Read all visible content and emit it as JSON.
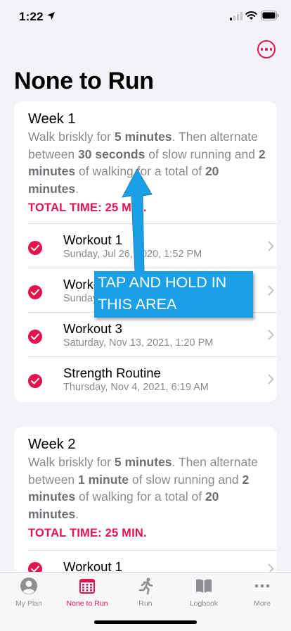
{
  "status_bar": {
    "time": "1:22"
  },
  "header": {
    "title": "None to Run"
  },
  "weeks": [
    {
      "title": "Week 1",
      "desc": {
        "p1": "Walk briskly for ",
        "b1": "5 minutes",
        "p2": ". Then alternate between ",
        "b2": "30 seconds",
        "p3": " of slow running and ",
        "b3": "2 minutes",
        "p4": " of walking for a total of ",
        "b4": "20 minutes",
        "p5": "."
      },
      "total": "TOTAL TIME: 25 MIN.",
      "workouts": [
        {
          "title": "Workout 1",
          "subtitle": "Sunday, Jul 26, 2020, 1:52 PM"
        },
        {
          "title": "Workout 2",
          "subtitle": "Sunday, Jul 26, 2020"
        },
        {
          "title": "Workout 3",
          "subtitle": "Saturday, Nov 13, 2021, 1:20 PM"
        },
        {
          "title": "Strength Routine",
          "subtitle": "Thursday, Nov 4, 2021, 6:19 AM"
        }
      ]
    },
    {
      "title": "Week 2",
      "desc": {
        "p1": "Walk briskly for ",
        "b1": "5 minutes",
        "p2": ". Then alternate between ",
        "b2": "1 minute",
        "p3": " of slow running and ",
        "b3": "2 minutes",
        "p4": " of walking for a total of ",
        "b4": "20 minutes",
        "p5": "."
      },
      "total": "TOTAL TIME: 25 MIN.",
      "workouts": [
        {
          "title": "Workout 1",
          "subtitle": ""
        }
      ]
    }
  ],
  "callout": {
    "line1": "TAP AND HOLD IN",
    "line2": "THIS AREA"
  },
  "tabs": [
    {
      "label": "My Plan",
      "icon": "person-circle-icon"
    },
    {
      "label": "None to Run",
      "icon": "calendar-icon"
    },
    {
      "label": "Run",
      "icon": "runner-icon"
    },
    {
      "label": "Logbook",
      "icon": "book-icon"
    },
    {
      "label": "More",
      "icon": "ellipsis-icon"
    }
  ],
  "colors": {
    "accent": "#e3134e",
    "callout": "#1aa0e6",
    "background": "#f2f2f7"
  }
}
